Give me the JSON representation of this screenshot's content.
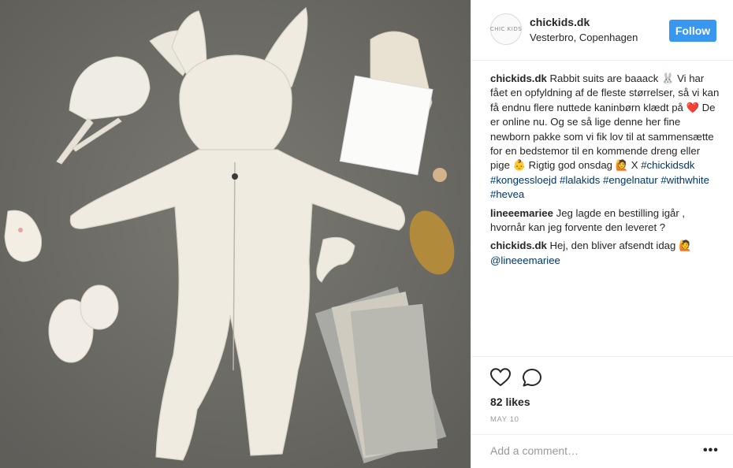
{
  "post": {
    "username": "chickids.dk",
    "location": "Vesterbro, Copenhagen",
    "avatar_text": "CHIC KIDS",
    "follow_label": "Follow",
    "photo_icon": "product-photo",
    "caption": {
      "user": "chickids.dk",
      "segments": [
        {
          "text": "Rabbit suits are baaack 🐰 Vi har fået en opfyldning af de fleste størrelser, så vi kan få endnu flere nuttede kaninbørn klædt på "
        },
        {
          "text": "❤️",
          "heart": true
        },
        {
          "text": " De er online nu. Og se så lige denne her fine newborn pakke som vi fik lov til at sammensætte for en bedstemor til en kommende dreng eller pige 👶 Rigtig god onsdag 🙋 X "
        }
      ],
      "hashtags": [
        "#chickidsdk",
        "#kongessloejd",
        "#lalakids",
        "#engelnatur",
        "#withwhite",
        "#hevea"
      ]
    },
    "comments": [
      {
        "user": "lineeemariee",
        "text": "Jeg lagde en bestilling igår , hvornår kan jeg forvente den leveret ?"
      },
      {
        "user": "chickids.dk",
        "text": "Hej, den bliver afsendt idag 🙋",
        "mention": "@lineeemariee"
      }
    ],
    "likes": "82 likes",
    "date": "MAY 10",
    "add_comment_placeholder": "Add a comment…",
    "more_label": "•••"
  }
}
